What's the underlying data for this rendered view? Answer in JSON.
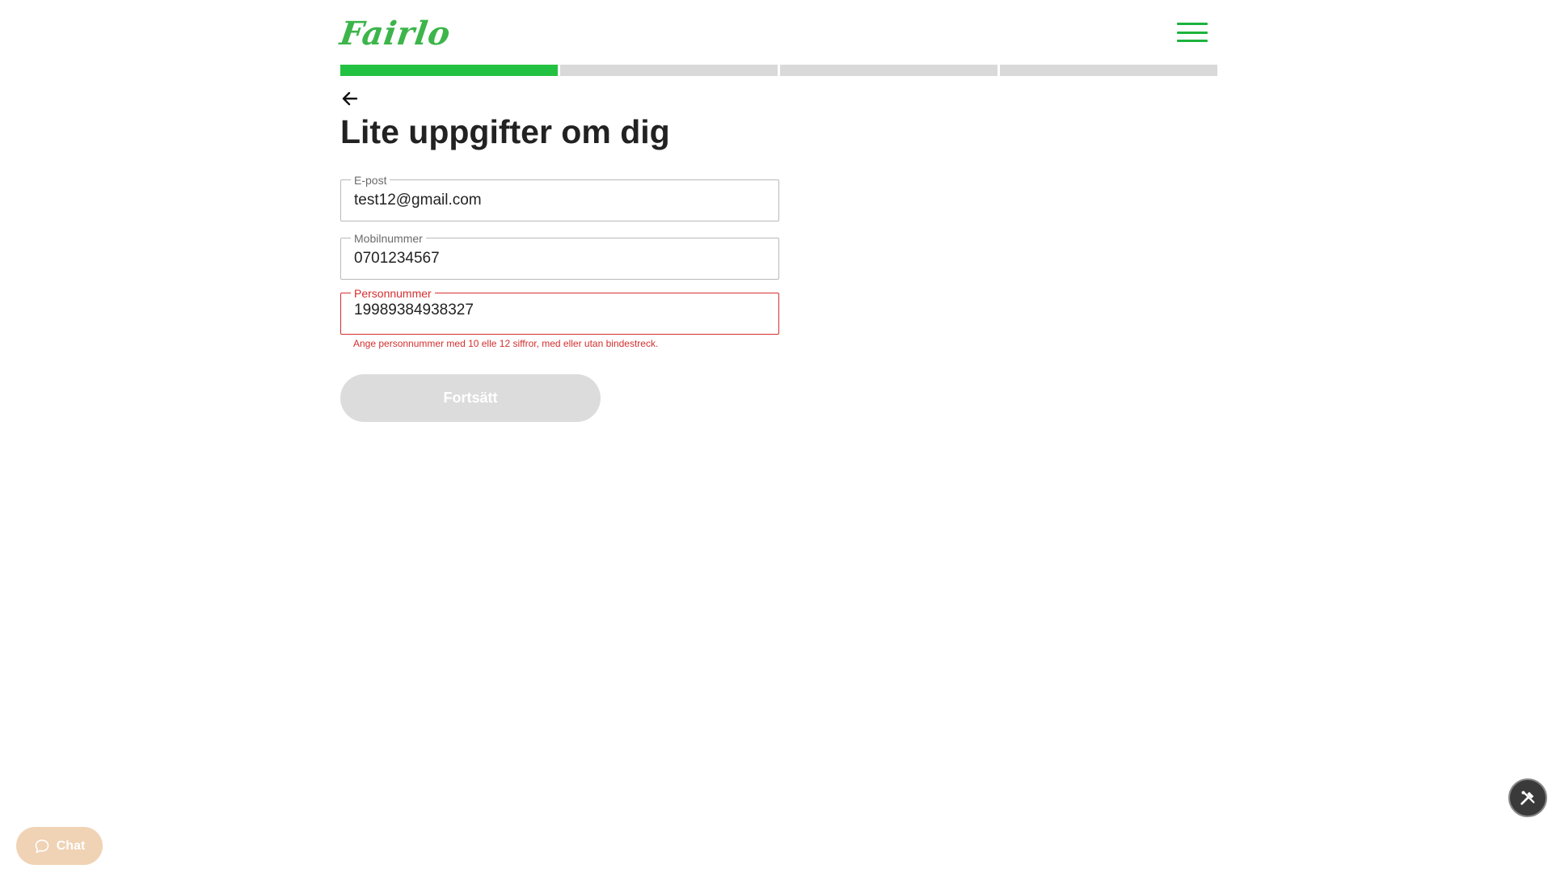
{
  "header": {
    "logo_text": "Fairlo",
    "menu_icon": "hamburger-icon"
  },
  "progress": {
    "total_steps": 4,
    "current_step": 1,
    "steps": [
      1,
      0,
      0,
      0
    ],
    "active_color": "#23c141",
    "inactive_color": "#d9d9d9"
  },
  "page": {
    "back_icon": "arrow-left-icon",
    "title": "Lite uppgifter om dig"
  },
  "form": {
    "email": {
      "label": "E-post",
      "value": "test12@gmail.com"
    },
    "mobile": {
      "label": "Mobilnummer",
      "value": "0701234567"
    },
    "personnummer": {
      "label": "Personnummer",
      "value": "19989384938327",
      "error": "Ange personnummer med 10 elle 12 siffror, med eller utan bindestreck."
    },
    "submit_label": "Fortsätt"
  },
  "floating": {
    "tools_icon": "tools-icon",
    "chat_label": "Chat",
    "chat_icon": "chat-bubble-icon"
  },
  "colors": {
    "brand_green": "#1db33e",
    "error_red": "#d32f2f",
    "disabled_button": "#dcdcdc"
  }
}
